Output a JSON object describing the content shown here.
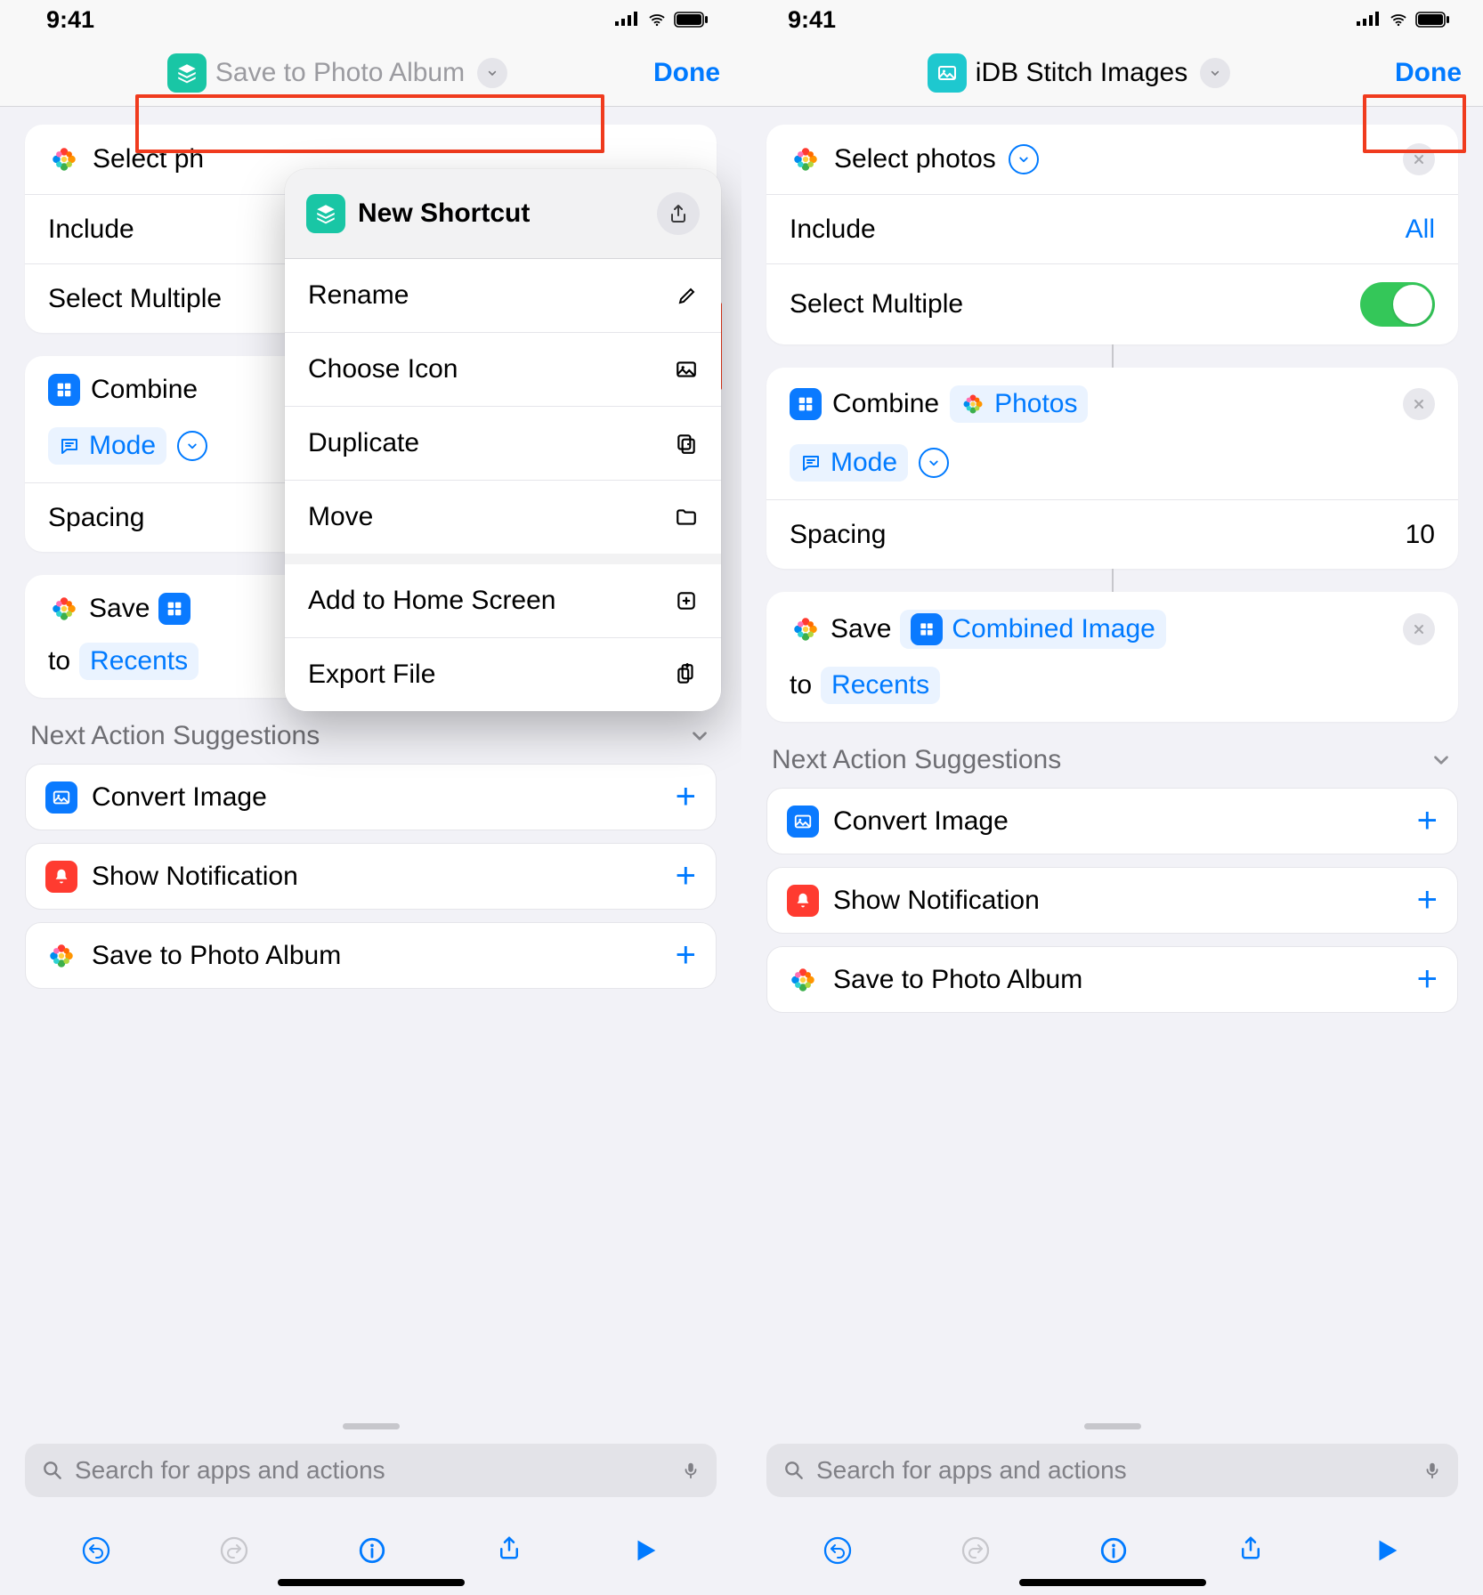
{
  "status": {
    "time": "9:41"
  },
  "left": {
    "nav_title": "Save to Photo Album",
    "done": "Done",
    "block1": {
      "title": "Select ph",
      "include_label": "Include",
      "multiple_label": "Select Multiple"
    },
    "block2": {
      "combine": "Combine",
      "mode": "Mode",
      "spacing_label": "Spacing"
    },
    "block3": {
      "save": "Save",
      "to": "to",
      "recents": "Recents"
    },
    "popover": {
      "title": "New Shortcut",
      "rename": "Rename",
      "choose_icon": "Choose Icon",
      "duplicate": "Duplicate",
      "move": "Move",
      "add_home": "Add to Home Screen",
      "export": "Export File"
    }
  },
  "right": {
    "nav_title": "iDB Stitch Images",
    "done": "Done",
    "block1": {
      "title": "Select photos",
      "include_label": "Include",
      "include_value": "All",
      "multiple_label": "Select Multiple"
    },
    "block2": {
      "combine": "Combine",
      "photos": "Photos",
      "mode": "Mode",
      "spacing_label": "Spacing",
      "spacing_value": "10"
    },
    "block3": {
      "save": "Save",
      "combined": "Combined Image",
      "to": "to",
      "recents": "Recents"
    }
  },
  "suggestions": {
    "header": "Next Action Suggestions",
    "items": [
      "Convert Image",
      "Show Notification",
      "Save to Photo Album"
    ]
  },
  "search": {
    "placeholder": "Search for apps and actions"
  }
}
